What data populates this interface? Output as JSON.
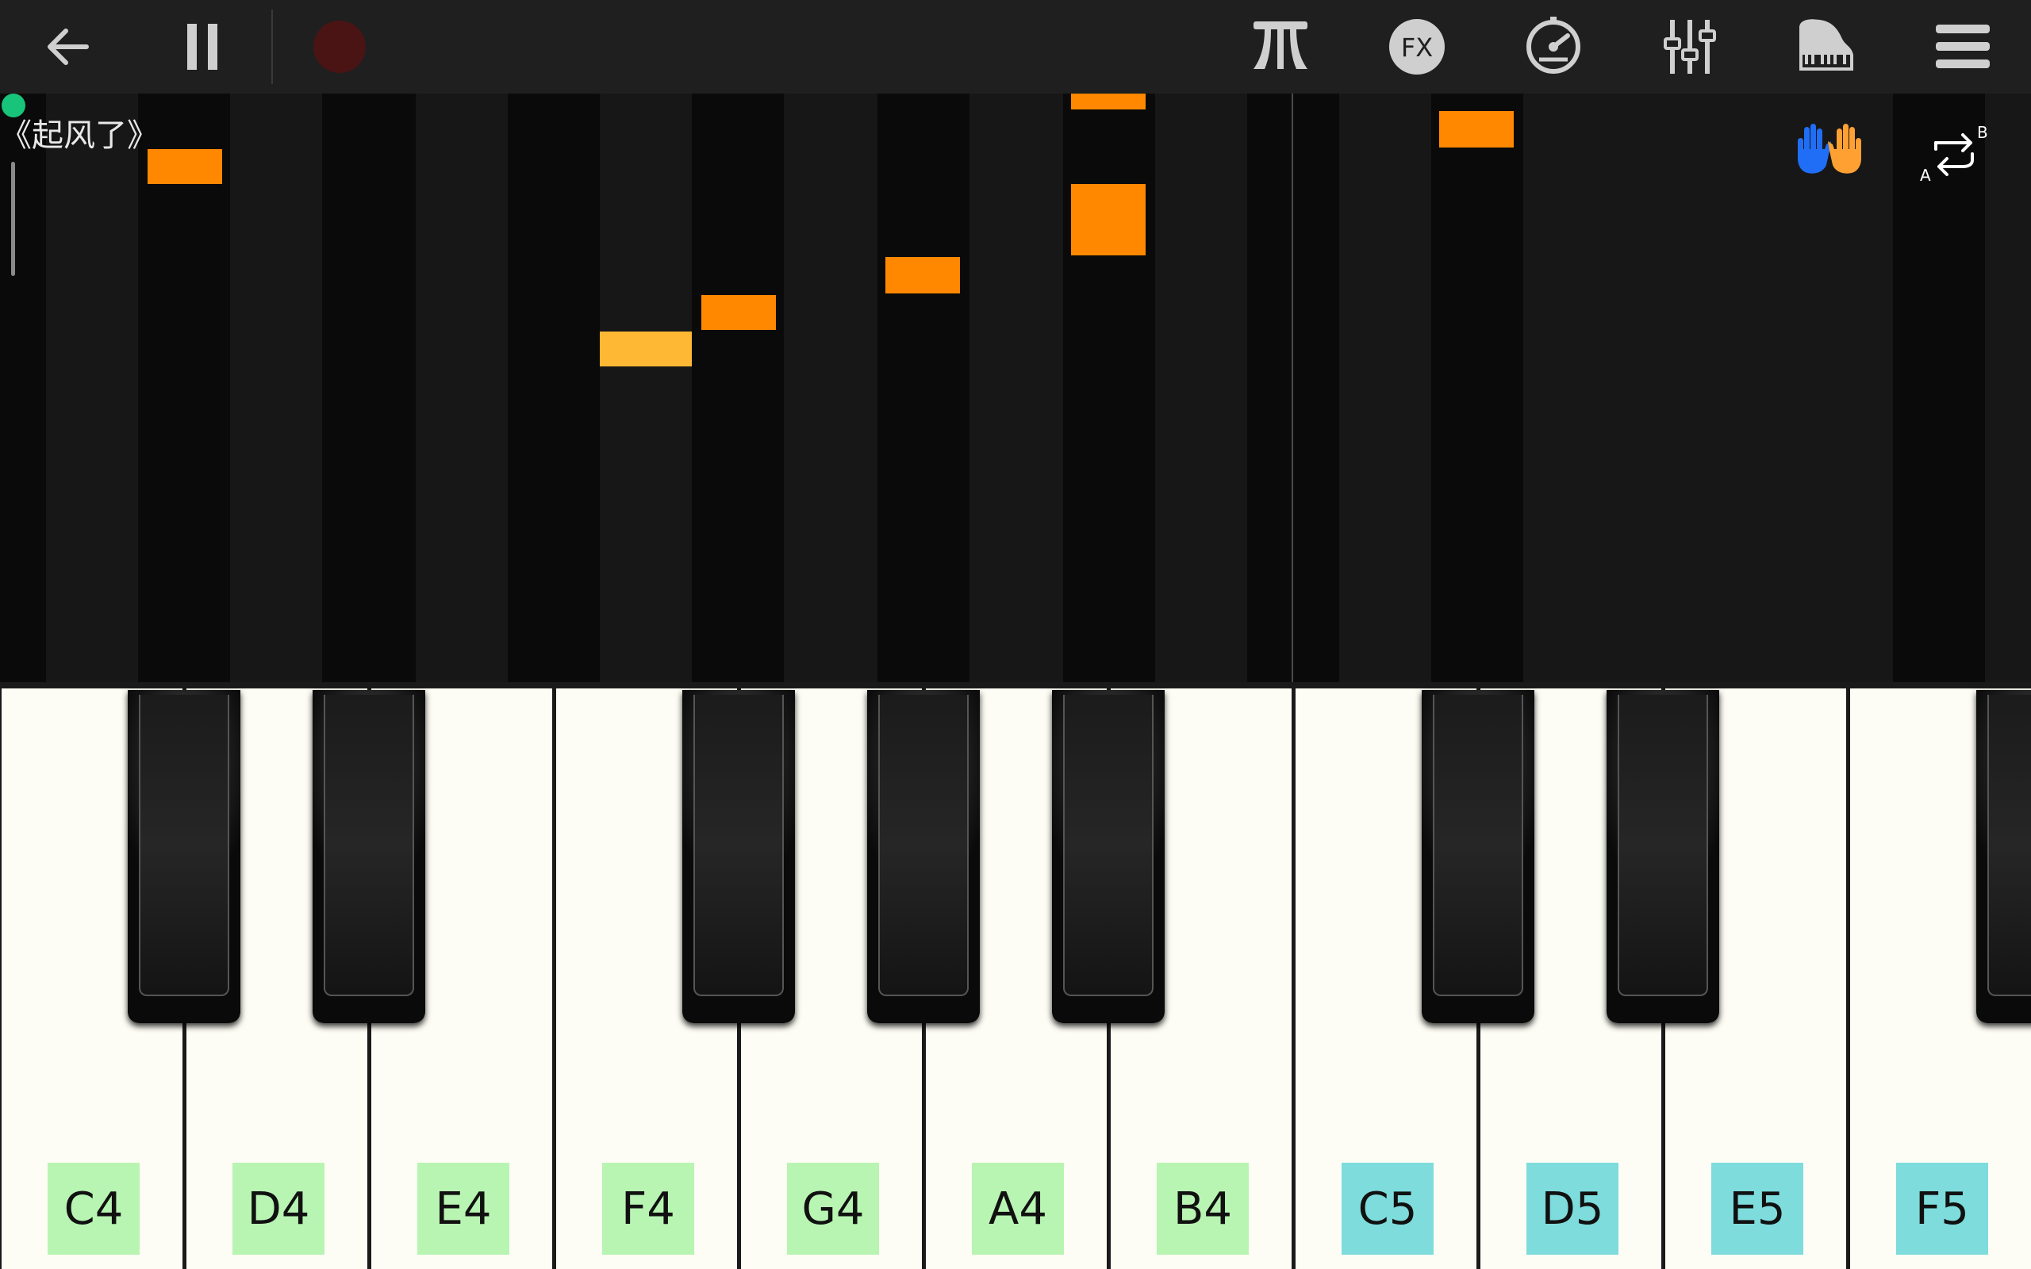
{
  "toolbar": {
    "left": [
      {
        "name": "back-arrow-icon"
      },
      {
        "name": "pause-icon"
      },
      {
        "name": "record-icon"
      }
    ],
    "right": [
      {
        "name": "sustain-pedal-icon"
      },
      {
        "name": "fx-icon",
        "text": "FX"
      },
      {
        "name": "metronome-icon"
      },
      {
        "name": "mixer-sliders-icon"
      },
      {
        "name": "grand-piano-icon"
      },
      {
        "name": "menu-icon"
      }
    ]
  },
  "song": {
    "title": "《起风了》"
  },
  "practice": {
    "left_hand_color": "#1f6ef5",
    "right_hand_color": "#ffa033",
    "ab_loop_label_a": "A",
    "ab_loop_label_b": "B"
  },
  "colors": {
    "note": "#ff8800",
    "active_note": "#ffb833",
    "label_octave4": "#b8f5b2",
    "label_octave5": "#7edcdc",
    "progress": "#18c47a"
  },
  "keyboard": {
    "white_keys": [
      {
        "label": "C4",
        "octave": 4
      },
      {
        "label": "D4",
        "octave": 4
      },
      {
        "label": "E4",
        "octave": 4
      },
      {
        "label": "F4",
        "octave": 4
      },
      {
        "label": "G4",
        "octave": 4
      },
      {
        "label": "A4",
        "octave": 4
      },
      {
        "label": "B4",
        "octave": 4
      },
      {
        "label": "C5",
        "octave": 5
      },
      {
        "label": "D5",
        "octave": 5
      },
      {
        "label": "E5",
        "octave": 5
      },
      {
        "label": "F5",
        "octave": 5
      }
    ]
  }
}
